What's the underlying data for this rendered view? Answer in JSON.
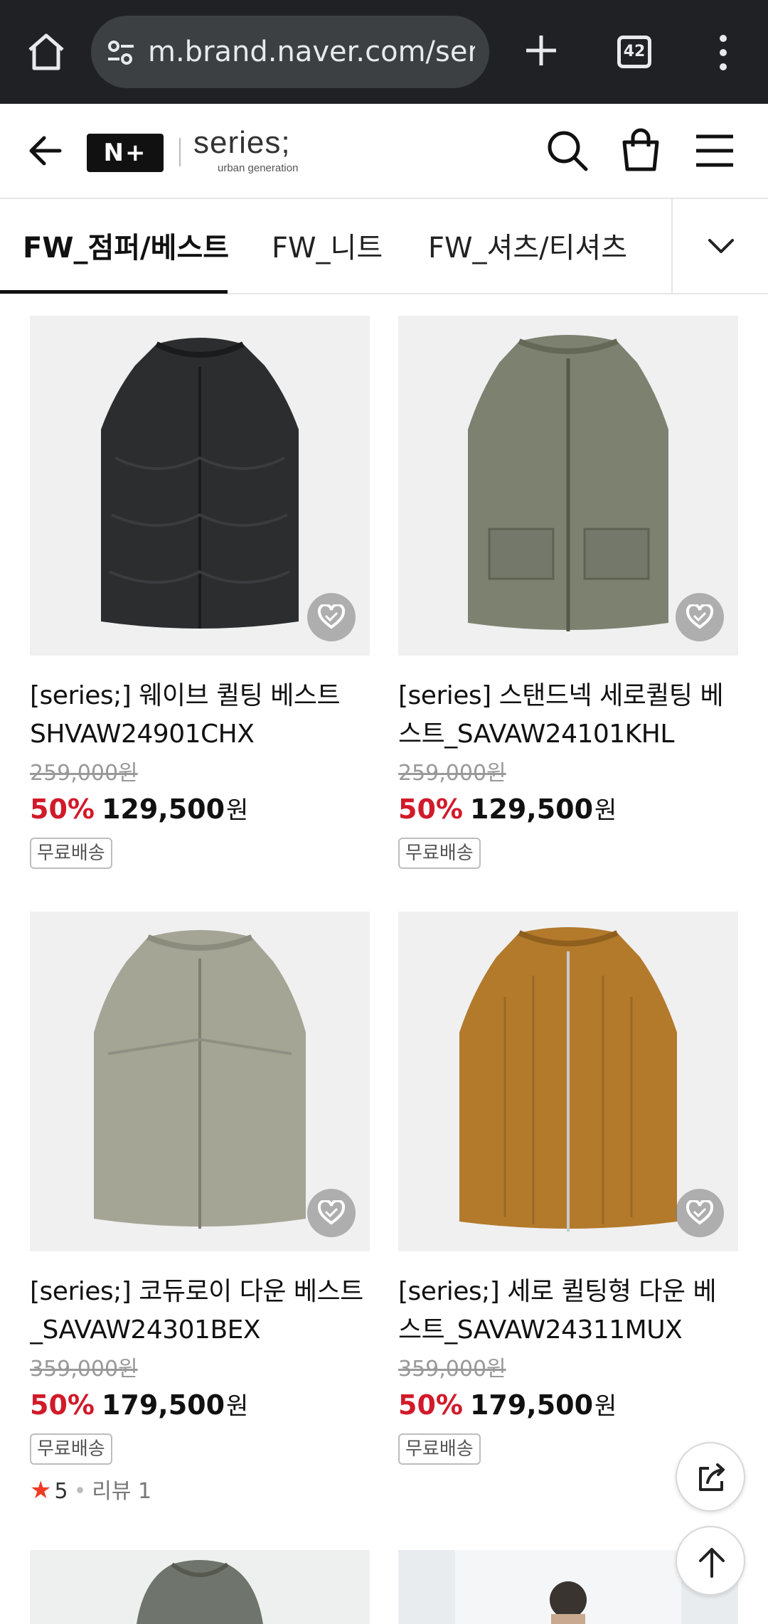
{
  "browser": {
    "url": "m.brand.naver.com/series",
    "tab_count": "42"
  },
  "header": {
    "logo_text": "N+",
    "brand_name": "series;",
    "brand_subtitle": "urban generation"
  },
  "tabs": [
    {
      "label": "FW_점퍼/베스트",
      "active": true
    },
    {
      "label": "FW_니트",
      "active": false
    },
    {
      "label": "FW_셔츠/티셔츠",
      "active": false
    }
  ],
  "products": [
    {
      "title": "[series;] 웨이브 퀼팅 베스트 SHVAW24901CHX",
      "original_price": "259,000원",
      "discount": "50%",
      "price": "129,500",
      "currency": "원",
      "badge": "무료배송",
      "garment_color": "#2c2d2f"
    },
    {
      "title": "[series] 스탠드넥 세로퀼팅 베스트_SAVAW24101KHL",
      "original_price": "259,000원",
      "discount": "50%",
      "price": "129,500",
      "currency": "원",
      "badge": "무료배송",
      "garment_color": "#7d8270"
    },
    {
      "title": "[series;] 코듀로이 다운 베스트_SAVAW24301BEX",
      "original_price": "359,000원",
      "discount": "50%",
      "price": "179,500",
      "currency": "원",
      "badge": "무료배송",
      "rating": {
        "star": "★",
        "score": "5",
        "separator": "•",
        "reviews": "리뷰 1"
      },
      "garment_color": "#a5a596"
    },
    {
      "title": "[series;] 세로 퀼팅형 다운 베스트_SAVAW24311MUX",
      "original_price": "359,000원",
      "discount": "50%",
      "price": "179,500",
      "currency": "원",
      "badge": "무료배송",
      "garment_color": "#b37a2c"
    }
  ],
  "colors": {
    "discount_red": "#d11a2a",
    "star_orange": "#ef3b25",
    "chrome_dark": "#202124"
  }
}
